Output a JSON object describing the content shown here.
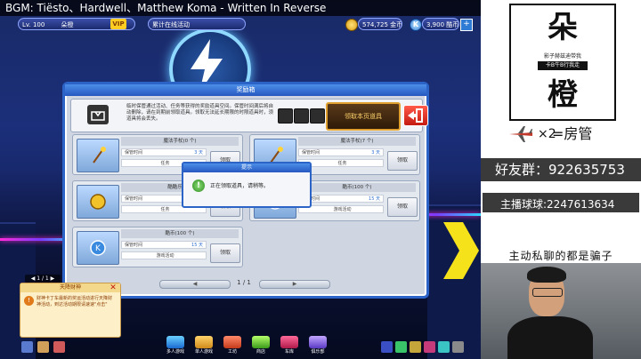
{
  "bgm": {
    "text": "BGM: Tiësto、Hardwell、Matthew Koma - Written In Reverse"
  },
  "hud": {
    "level": "Lv. 100",
    "player": "朵橙",
    "vip": "VIP",
    "event_label": "累计在线活动",
    "gold": "574,725 金币",
    "kcoin": "3,900 酷币",
    "add_label": "+"
  },
  "dialog": {
    "title": "奖励箱",
    "info_text": "临时保管通过活动、任务等获得的奖励道具空间。保管时间满后将自动删除，请在到期前领取道具。领取无法延长期限的时限道具时，须道具将会丢失。",
    "claim_all": "领取本页道具",
    "exit_icon": "exit-icon",
    "cards": [
      {
        "name": "魔法手杖(0 个)",
        "row1_label": "保管时间",
        "row1_value": "3 天",
        "row2_label": "任务",
        "claim": "领取",
        "icon": "wand-icon"
      },
      {
        "name": "魔法手杖(7 个)",
        "row1_label": "保管时间",
        "row1_value": "3 天",
        "row2_label": "任务",
        "claim": "领取",
        "icon": "wand-icon"
      },
      {
        "name": "酷酷乐优币",
        "row1_label": "保管时间",
        "row1_value": "",
        "row2_label": "任务",
        "claim": "领取",
        "icon": "coin-icon"
      },
      {
        "name": "酷币(100 个)",
        "row1_label": "保管时间",
        "row1_value": "15 天",
        "row2_label": "游戏活动",
        "claim": "领取",
        "icon": "kcoin-icon"
      },
      {
        "name": "酷币(100 个)",
        "row1_label": "保管时间",
        "row1_value": "15 天",
        "row2_label": "游戏活动",
        "claim": "领取",
        "icon": "kcoin-icon"
      }
    ],
    "pager": {
      "prev": "◀",
      "current": "1 / 1",
      "next": "▶"
    }
  },
  "popup": {
    "title": "提示",
    "message": "正在领取道具，请稍等。",
    "icon": "exclamation-icon"
  },
  "notice": {
    "page": "◀ 1 / 1 ▶",
    "title": "天降财神",
    "text": "财神卡丁车最新的奖运活动进行天降财神活动，到达活动期限请速速\"点击\"",
    "close": "✕"
  },
  "bottom_menu": [
    {
      "label": "多人游戏",
      "icon": "multiplayer-icon"
    },
    {
      "label": "单人游戏",
      "icon": "singleplayer-icon"
    },
    {
      "label": "工坊",
      "icon": "workshop-icon"
    },
    {
      "label": "商店",
      "icon": "shop-icon"
    },
    {
      "label": "车库",
      "icon": "garage-icon"
    },
    {
      "label": "俱乐部",
      "icon": "club-icon"
    }
  ],
  "panel": {
    "brand_char_1": "朵",
    "brand_line": "影子赫兹迪带我",
    "brand_tag": "卡B牛B行我走",
    "brand_char_2": "橙",
    "admin_mult": "×2",
    "admin_text": "=房管",
    "fan_group": "好友群：922635753",
    "qq_group": "主播球球:2247613634",
    "scam_warning": "主动私聊的都是骗子"
  },
  "colors": {
    "accent_blue": "#2c63c7",
    "gold": "#e0a030",
    "exit_red": "#c41a10"
  }
}
